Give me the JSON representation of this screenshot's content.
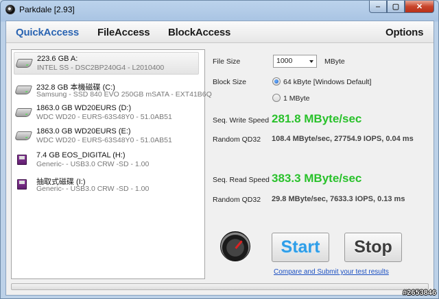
{
  "window": {
    "title": "Parkdale [2.93]",
    "min": "‒",
    "max": "▢",
    "close": "✕"
  },
  "menu": {
    "quick": "QuickAccess",
    "file": "FileAccess",
    "block": "BlockAccess",
    "options": "Options"
  },
  "drives": [
    {
      "name": "223.6 GB A:",
      "detail": "INTEL SS - DSC2BP240G4 - L2010400",
      "type": "hdd-icon"
    },
    {
      "name": "232.8 GB 本機磁碟 (C:)",
      "detail": "Samsung - SSD 840 EVO 250GB mSATA - EXT41B6Q",
      "type": "hdd-icon"
    },
    {
      "name": "1863.0 GB WD20EURS (D:)",
      "detail": "WDC WD20 - EURS-63S48Y0 - 51.0AB51",
      "type": "hdd-icon"
    },
    {
      "name": "1863.0 GB WD20EURS (E:)",
      "detail": "WDC WD20 - EURS-63S48Y0 - 51.0AB51",
      "type": "hdd-icon"
    },
    {
      "name": "7.4 GB EOS_DIGITAL (H:)",
      "detail": "Generic- - USB3.0 CRW   -SD - 1.00",
      "type": "usb-icon"
    },
    {
      "name": "抽取式磁碟 (I:)",
      "detail": "Generic- - USB3.0 CRW   -SD - 1.00",
      "type": "usb-icon"
    }
  ],
  "settings": {
    "file_size_label": "File Size",
    "file_size_value": "1000",
    "file_size_unit": "MByte",
    "block_size_label": "Block Size",
    "block_opt1": "64 kByte [Windows Default]",
    "block_opt2": "1 MByte"
  },
  "results": {
    "write_label": "Seq. Write Speed",
    "write_value": "281.8 MByte/sec",
    "rand_label_1": "Random QD32",
    "rand_value_1": "108.4 MByte/sec, 27754.9 IOPS, 0.04 ms",
    "read_label": "Seq. Read Speed",
    "read_value": "383.3 MByte/sec",
    "rand_label_2": "Random QD32",
    "rand_value_2": "29.8 MByte/sec, 7633.3 IOPS, 0.13 ms"
  },
  "actions": {
    "start": "Start",
    "stop": "Stop",
    "compare_link": "Compare and Submit your test results"
  },
  "watermark": "#2653846",
  "colors": {
    "accent": "#2a64b2",
    "speed": "#29c12b",
    "start": "#2f9ee8"
  }
}
